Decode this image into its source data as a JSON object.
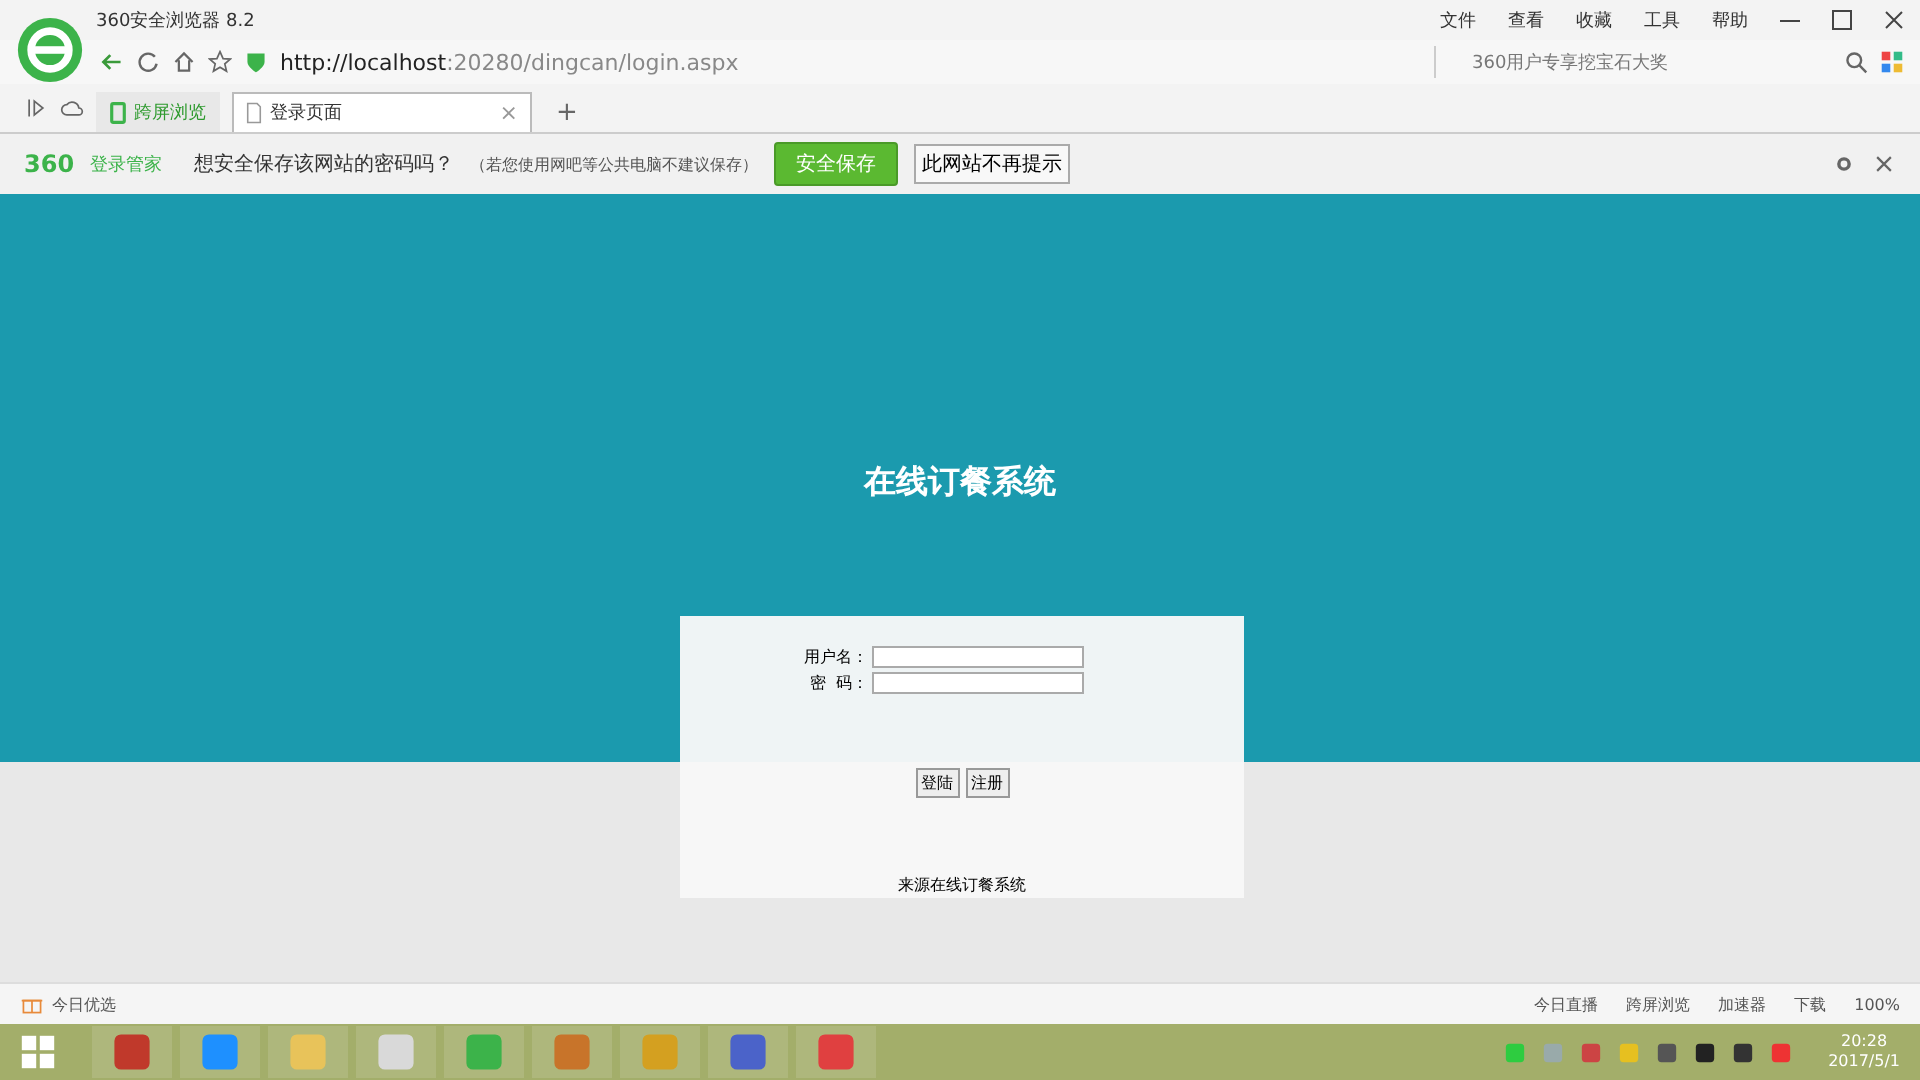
{
  "window": {
    "title": "360安全浏览器 8.2",
    "menu": [
      "文件",
      "查看",
      "收藏",
      "工具",
      "帮助"
    ]
  },
  "address_bar": {
    "url_host": "http://localhost",
    "url_rest": ":20280/dingcan/login.aspx",
    "search_placeholder": "360用户专享挖宝石大奖"
  },
  "tabs": [
    {
      "label": "跨屏浏览",
      "kind": "pinned",
      "selected": false
    },
    {
      "label": "登录页面",
      "kind": "page",
      "selected": true,
      "close": "×"
    }
  ],
  "new_tab": "+",
  "password_bar": {
    "brand": "360",
    "brand_label": "登录管家",
    "question": "想安全保存该网站的密码吗？",
    "hint": "（若您使用网吧等公共电脑不建议保存）",
    "save_button": "安全保存",
    "never_button": "此网站不再提示"
  },
  "page": {
    "title": "在线订餐系统",
    "username_label": "用户名：",
    "password_label": "密  码：",
    "buttons": [
      "登陆",
      "注册"
    ],
    "footer": "来源在线订餐系统"
  },
  "status_bar": {
    "left": "今日优选",
    "right": [
      "今日直播",
      "跨屏浏览",
      "加速器",
      "下载"
    ],
    "zoom": "100%"
  },
  "taskbar": {
    "time": "20:28",
    "date": "2017/5/1"
  }
}
